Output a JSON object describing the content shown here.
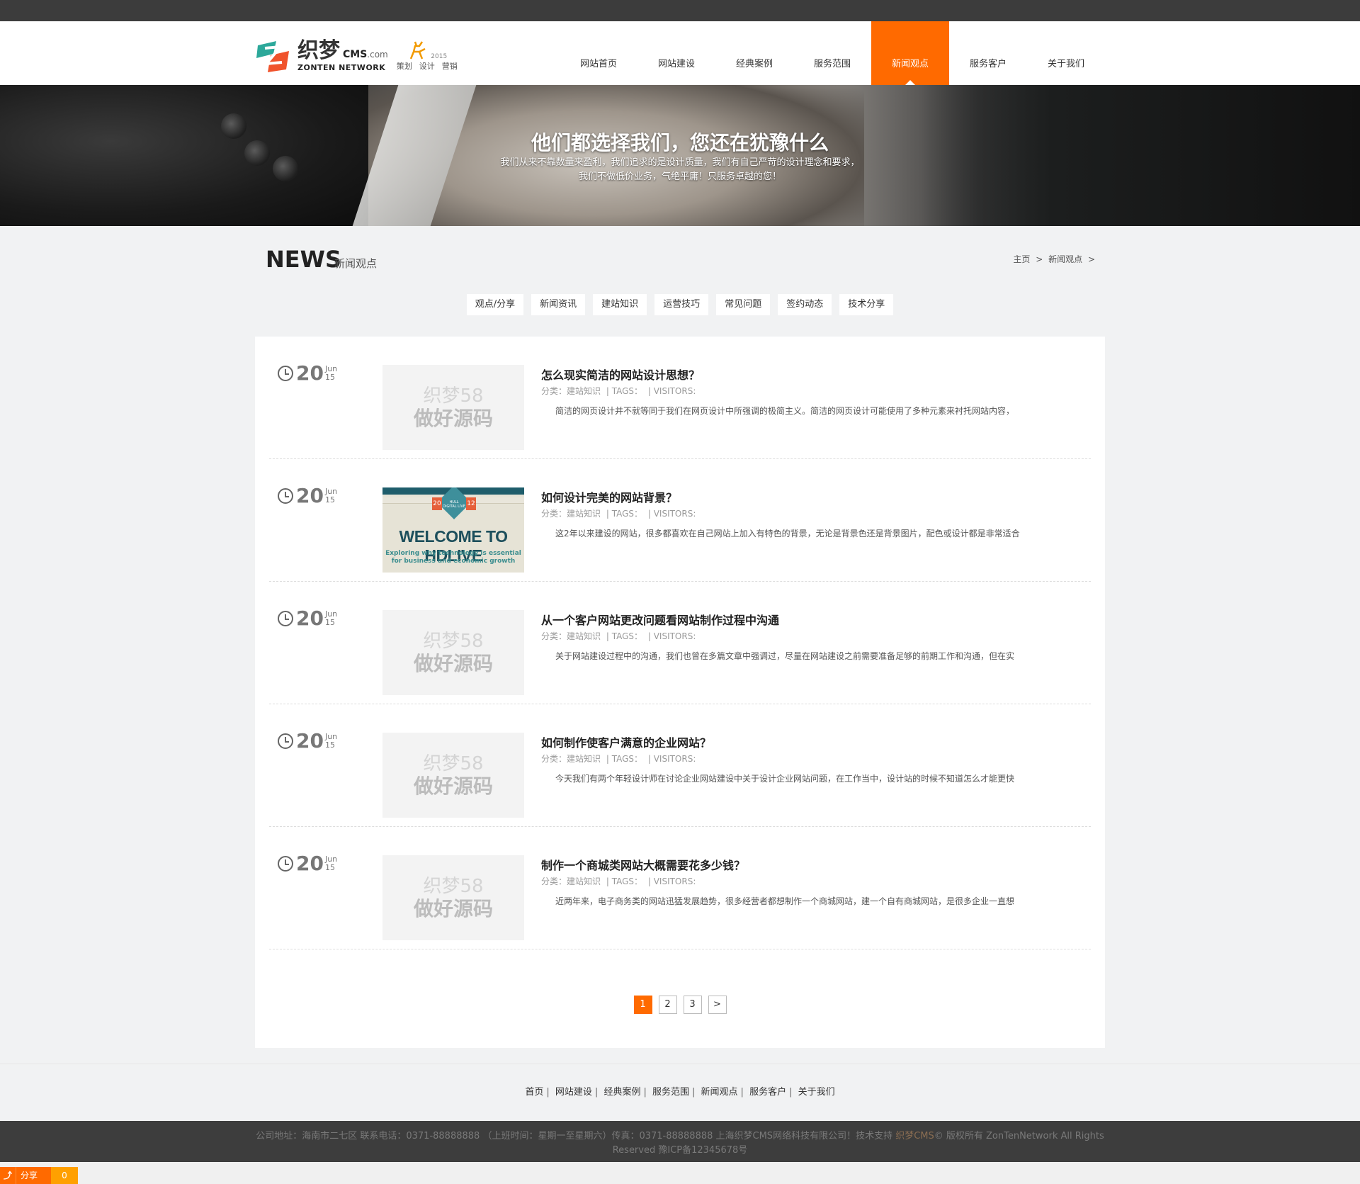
{
  "header": {
    "logo": {
      "cn": "织梦",
      "cms": "CMS",
      "com": ".com",
      "en": "ZONTEN NETWORK",
      "year": "2015",
      "tags": [
        "策划",
        "设计",
        "营销"
      ]
    },
    "nav": [
      {
        "label": "网站首页",
        "active": false
      },
      {
        "label": "网站建设",
        "active": false
      },
      {
        "label": "经典案例",
        "active": false
      },
      {
        "label": "服务范围",
        "active": false
      },
      {
        "label": "新闻观点",
        "active": true
      },
      {
        "label": "服务客户",
        "active": false
      },
      {
        "label": "关于我们",
        "active": false
      }
    ]
  },
  "banner": {
    "title": "他们都选择我们，您还在犹豫什么",
    "sub1": "我们从来不靠数量来盈利，我们追求的是设计质量，我们有自己严苛的设计理念和要求，",
    "sub2": "我们不做低价业务，气绝平庸！只服务卓越的您！"
  },
  "page": {
    "title_en": "NEWS",
    "title_cn": "新闻观点",
    "breadcrumb": [
      "主页",
      ">",
      "新闻观点",
      ">"
    ]
  },
  "categories": [
    "观点/分享",
    "新闻资讯",
    "建站知识",
    "运营技巧",
    "常见问题",
    "签约动态",
    "技术分享"
  ],
  "articles": [
    {
      "day": "20",
      "month": "Jun",
      "year": "15",
      "thumb": "placeholder",
      "title": "怎么现实简洁的网站设计思想？",
      "meta_cat": "分类：建站知识",
      "meta_tags": "| TAGS：",
      "meta_visitors": "| VISITORS:",
      "desc": "简洁的网页设计并不就等同于我们在网页设计中所强调的极简主义。简洁的网页设计可能使用了多种元素来衬托网站内容，"
    },
    {
      "day": "20",
      "month": "Jun",
      "year": "15",
      "thumb": "holive",
      "title": "如何设计完美的网站背景？",
      "meta_cat": "分类：建站知识",
      "meta_tags": "| TAGS：",
      "meta_visitors": "| VISITORS:",
      "desc": "这2年以来建设的网站，很多都喜欢在自己网站上加入有特色的背景，无论是背景色还是背景图片，配色或设计都是非常适合"
    },
    {
      "day": "20",
      "month": "Jun",
      "year": "15",
      "thumb": "placeholder",
      "title": "从一个客户网站更改问题看网站制作过程中沟通",
      "meta_cat": "分类：建站知识",
      "meta_tags": "| TAGS：",
      "meta_visitors": "| VISITORS:",
      "desc": "关于网站建设过程中的沟通，我们也曾在多篇文章中强调过，尽量在网站建设之前需要准备足够的前期工作和沟通，但在实"
    },
    {
      "day": "20",
      "month": "Jun",
      "year": "15",
      "thumb": "placeholder",
      "title": "如何制作使客户满意的企业网站？",
      "meta_cat": "分类：建站知识",
      "meta_tags": "| TAGS：",
      "meta_visitors": "| VISITORS:",
      "desc": "今天我们有两个年轻设计师在讨论企业网站建设中关于设计企业网站问题，在工作当中，设计站的时候不知道怎么才能更快"
    },
    {
      "day": "20",
      "month": "Jun",
      "year": "15",
      "thumb": "placeholder",
      "title": "制作一个商城类网站大概需要花多少钱？",
      "meta_cat": "分类：建站知识",
      "meta_tags": "| TAGS：",
      "meta_visitors": "| VISITORS:",
      "desc": "近两年来，电子商务类的网站迅猛发展趋势，很多经营者都想制作一个商城网站，建一个自有商城网站，是很多企业一直想"
    }
  ],
  "placeholder": {
    "line1": "织梦58",
    "line2": "做好源码"
  },
  "holive": {
    "badge1": "20",
    "badge2": "12",
    "hex": "HULL DIGITAL LIVE",
    "big": "WELCOME TO HDLIVE",
    "small1": "Exploring why technology is essential",
    "small2": "for business and economic growth"
  },
  "pager": [
    {
      "label": "1",
      "active": true
    },
    {
      "label": "2",
      "active": false
    },
    {
      "label": "3",
      "active": false
    },
    {
      "label": ">",
      "active": false
    }
  ],
  "footer": {
    "links": [
      "首页",
      "网站建设",
      "经典案例",
      "服务范围",
      "新闻观点",
      "服务客户",
      "关于我们"
    ],
    "info_pre": "公司地址：海南市二七区 联系电话：0371-88888888 （上班时间：星期一至星期六）传真：0371-88888888 上海织梦CMS网络科技有限公司！技术支持 ",
    "info_link": "织梦CMS",
    "info_post": "© 版权所有 ZonTenNetwork All Rights",
    "info_line2": "Reserved 豫ICP备12345678号"
  },
  "share": {
    "label": "分享",
    "count": "0"
  },
  "colors": {
    "accent": "#ff6a00",
    "topbar": "#3c3c3c",
    "footer": "#3d3d3d"
  }
}
